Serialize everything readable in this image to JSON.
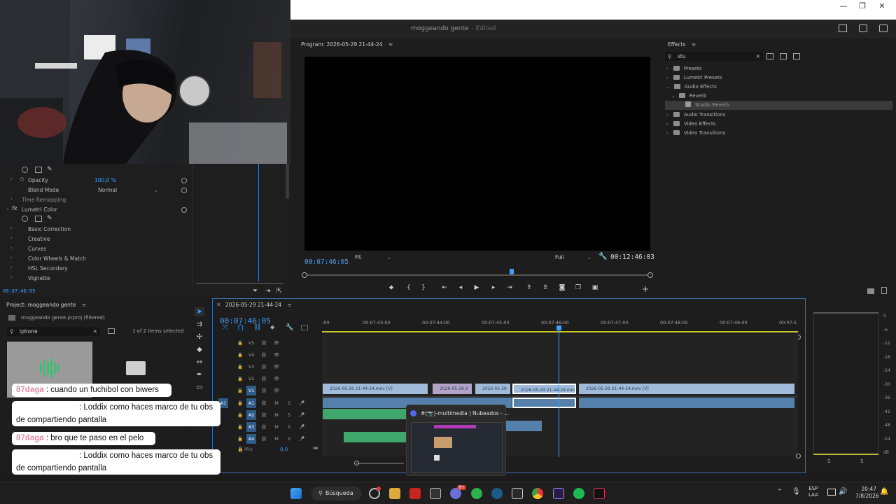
{
  "app": {
    "document_title": "moggeando gente",
    "edited_label": "- Edited"
  },
  "window_controls": {
    "minimize": "—",
    "restore": "❐",
    "close": "✕"
  },
  "effect_controls": {
    "opacity_label": "Opacity",
    "opacity_value": "100,0 %",
    "blend_mode_label": "Blend Mode",
    "blend_mode_value": "Normal",
    "time_remapping_label": "Time Remapping",
    "lumetri_label": "Lumetri Color",
    "sections": [
      "Basic Correction",
      "Creative",
      "Curves",
      "Color Wheels & Match",
      "HSL Secondary",
      "Vignette"
    ],
    "timecode": "00:07:46:05"
  },
  "program_monitor": {
    "title": "Program: 2026-05-29 21-44-24",
    "current_timecode": "00:07:46:05",
    "fit_value": "Fit",
    "quality_value": "Full",
    "duration_timecode": "00:12:46:03",
    "playhead_fraction": 0.6
  },
  "effects_panel": {
    "title": "Effects",
    "search_value": "stu",
    "tree": [
      {
        "label": "Presets",
        "level": 0,
        "open": false
      },
      {
        "label": "Lumetri Presets",
        "level": 0,
        "open": false
      },
      {
        "label": "Audio Effects",
        "level": 0,
        "open": true
      },
      {
        "label": "Reverb",
        "level": 1,
        "open": true
      },
      {
        "label": "Studio Reverb",
        "level": 2,
        "selected": true
      },
      {
        "label": "Audio Transitions",
        "level": 0,
        "open": false
      },
      {
        "label": "Video Effects",
        "level": 0,
        "open": false
      },
      {
        "label": "Video Transitions",
        "level": 0,
        "open": false
      }
    ]
  },
  "project_panel": {
    "title": "Project: moggeando gente",
    "file": "moggeando gente.prproj (filtered)",
    "search_value": "iphone",
    "selection_status": "1 of 2 items selected"
  },
  "timeline": {
    "sequence_name": "2026-05-29 21-44-24",
    "timecode": "00:07:46:05",
    "ruler": [
      ":00",
      "00:07:43:00",
      "00:07:44:00",
      "00:07:45:00",
      "00:07:46:00",
      "00:07:47:00",
      "00:07:48:00",
      "00:07:49:00",
      "00:07:5"
    ],
    "video_tracks": [
      "V5",
      "V4",
      "V3",
      "V2",
      "V1"
    ],
    "audio_tracks": [
      "A1",
      "A2",
      "A3",
      "A4"
    ],
    "mix_label": "Mix",
    "mix_value": "0,0",
    "clips": [
      {
        "label": "2026-05-29 21-44-24.mov [V]"
      },
      {
        "label": "2026-05-29 2"
      },
      {
        "label": "2026-05-29"
      },
      {
        "label": "2026-05-29 21-44-24.mov"
      },
      {
        "label": "2026-05-29 21-44-24.mov [V]"
      }
    ]
  },
  "meters": {
    "scale": [
      "0",
      "-6",
      "-12",
      "-18",
      "-24",
      "-30",
      "-36",
      "-42",
      "-48",
      "-54",
      "dB"
    ],
    "solo_labels": [
      "S",
      "S"
    ]
  },
  "chat": [
    {
      "user": "87daga",
      "message": " : cuando un fuchibol con biwers"
    },
    {
      "user": "",
      "message": ": Loddix como haces marco de tu obs de compartiendo pantalla"
    },
    {
      "user": "87daga",
      "message": " : bro que te paso en el pelo"
    },
    {
      "user": "",
      "message": ": Loddix como haces marco de tu obs de compartiendo pantalla"
    }
  ],
  "discord_preview": {
    "title": "#(📷)-multimedia | Nubeados - ..."
  },
  "taskbar": {
    "search_label": "Búsqueda",
    "language_top": "ESP",
    "language_bottom": "LAA",
    "time": "20:47",
    "date": "7/8/2026",
    "badge": "9+"
  }
}
